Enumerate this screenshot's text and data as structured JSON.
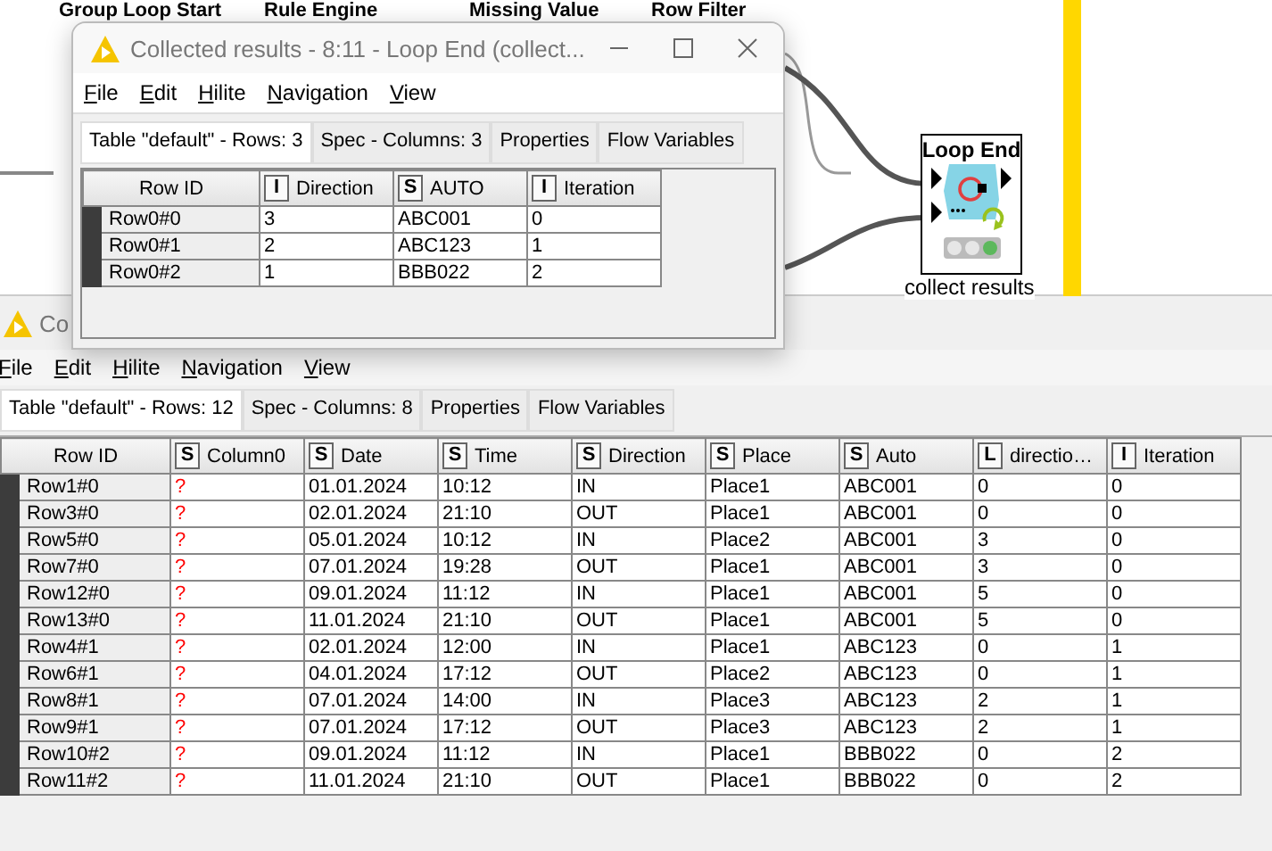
{
  "canvas": {
    "node_labels": [
      "Group Loop Start",
      "Rule Engine",
      "Missing Value",
      "Row Filter"
    ],
    "node": {
      "title": "Loop End",
      "label": "collect results",
      "status_lights": [
        {
          "on": false
        },
        {
          "on": false
        },
        {
          "on": true
        }
      ]
    }
  },
  "back_window": {
    "title": "Co",
    "menu": [
      "File",
      "Edit",
      "Hilite",
      "Navigation",
      "View"
    ],
    "tabs": [
      {
        "label": "Table \"default\" - Rows: 12",
        "selected": true
      },
      {
        "label": "Spec - Columns: 8",
        "selected": false
      },
      {
        "label": "Properties",
        "selected": false
      },
      {
        "label": "Flow Variables",
        "selected": false
      }
    ],
    "table": {
      "columns": [
        {
          "name": "Row ID"
        },
        {
          "type": "S",
          "name": "Column0",
          "missing": true
        },
        {
          "type": "S",
          "name": "Date"
        },
        {
          "type": "S",
          "name": "Time"
        },
        {
          "type": "S",
          "name": "Direction"
        },
        {
          "type": "S",
          "name": "Place"
        },
        {
          "type": "S",
          "name": "Auto"
        },
        {
          "type": "L",
          "name": "directio…"
        },
        {
          "type": "I",
          "name": "Iteration"
        }
      ],
      "rows": [
        [
          "Row1#0",
          "?",
          "01.01.2024",
          "10:12",
          "IN",
          "Place1",
          "ABC001",
          "0",
          "0"
        ],
        [
          "Row3#0",
          "?",
          "02.01.2024",
          "21:10",
          "OUT",
          "Place1",
          "ABC001",
          "0",
          "0"
        ],
        [
          "Row5#0",
          "?",
          "05.01.2024",
          "10:12",
          "IN",
          "Place2",
          "ABC001",
          "3",
          "0"
        ],
        [
          "Row7#0",
          "?",
          "07.01.2024",
          "19:28",
          "OUT",
          "Place1",
          "ABC001",
          "3",
          "0"
        ],
        [
          "Row12#0",
          "?",
          "09.01.2024",
          "11:12",
          "IN",
          "Place1",
          "ABC001",
          "5",
          "0"
        ],
        [
          "Row13#0",
          "?",
          "11.01.2024",
          "21:10",
          "OUT",
          "Place1",
          "ABC001",
          "5",
          "0"
        ],
        [
          "Row4#1",
          "?",
          "02.01.2024",
          "12:00",
          "IN",
          "Place1",
          "ABC123",
          "0",
          "1"
        ],
        [
          "Row6#1",
          "?",
          "04.01.2024",
          "17:12",
          "OUT",
          "Place2",
          "ABC123",
          "0",
          "1"
        ],
        [
          "Row8#1",
          "?",
          "07.01.2024",
          "14:00",
          "IN",
          "Place3",
          "ABC123",
          "2",
          "1"
        ],
        [
          "Row9#1",
          "?",
          "07.01.2024",
          "17:12",
          "OUT",
          "Place3",
          "ABC123",
          "2",
          "1"
        ],
        [
          "Row10#2",
          "?",
          "09.01.2024",
          "11:12",
          "IN",
          "Place1",
          "BBB022",
          "0",
          "2"
        ],
        [
          "Row11#2",
          "?",
          "11.01.2024",
          "21:10",
          "OUT",
          "Place1",
          "BBB022",
          "0",
          "2"
        ]
      ]
    }
  },
  "front_window": {
    "title": "Collected results - 8:11 - Loop End (collect...",
    "menu": [
      "File",
      "Edit",
      "Hilite",
      "Navigation",
      "View"
    ],
    "tabs": [
      {
        "label": "Table \"default\" - Rows: 3",
        "selected": true
      },
      {
        "label": "Spec - Columns: 3",
        "selected": false
      },
      {
        "label": "Properties",
        "selected": false
      },
      {
        "label": "Flow Variables",
        "selected": false
      }
    ],
    "table": {
      "columns": [
        {
          "name": "Row ID"
        },
        {
          "type": "I",
          "name": "Direction"
        },
        {
          "type": "S",
          "name": "AUTO"
        },
        {
          "type": "I",
          "name": "Iteration"
        }
      ],
      "rows": [
        [
          "Row0#0",
          "3",
          "ABC001",
          "0"
        ],
        [
          "Row0#1",
          "2",
          "ABC123",
          "1"
        ],
        [
          "Row0#2",
          "1",
          "BBB022",
          "2"
        ]
      ]
    }
  }
}
